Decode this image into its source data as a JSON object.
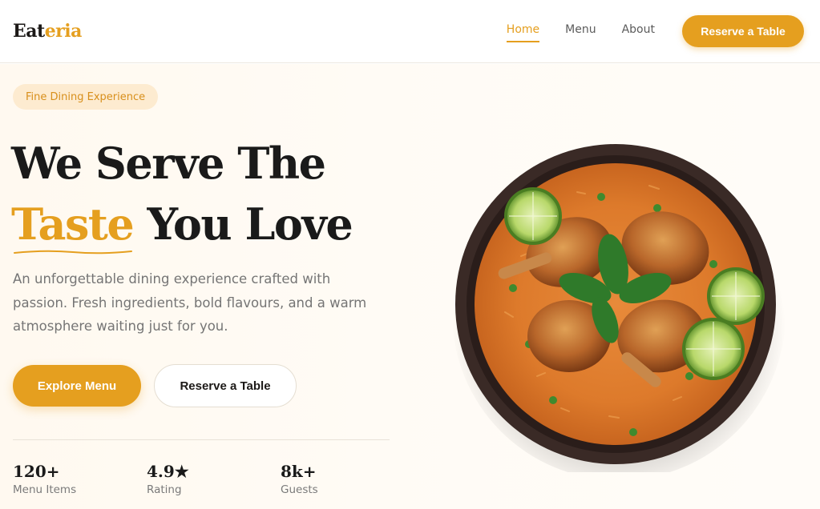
{
  "brand": {
    "part1": "Eat",
    "part2": "eria"
  },
  "nav": {
    "items": [
      {
        "label": "Home",
        "active": true
      },
      {
        "label": "Menu",
        "active": false
      },
      {
        "label": "About",
        "active": false
      }
    ],
    "cta": "Reserve a Table"
  },
  "hero": {
    "badge": "Fine Dining Experience",
    "headline_line1": "We Serve The",
    "headline_accent": "Taste",
    "headline_rest": "You Love",
    "description": "An unforgettable dining experience crafted with passion. Fresh ingredients, bold flavours, and a warm atmosphere waiting just for you.",
    "primary_button": "Explore Menu",
    "secondary_button": "Reserve a Table"
  },
  "stats": [
    {
      "value": "120+",
      "label": "Menu Items"
    },
    {
      "value": "4.9★",
      "label": "Rating"
    },
    {
      "value": "8k+",
      "label": "Guests"
    }
  ],
  "colors": {
    "accent": "#e59f1f",
    "text": "#1a1a1a",
    "muted": "#757575"
  }
}
